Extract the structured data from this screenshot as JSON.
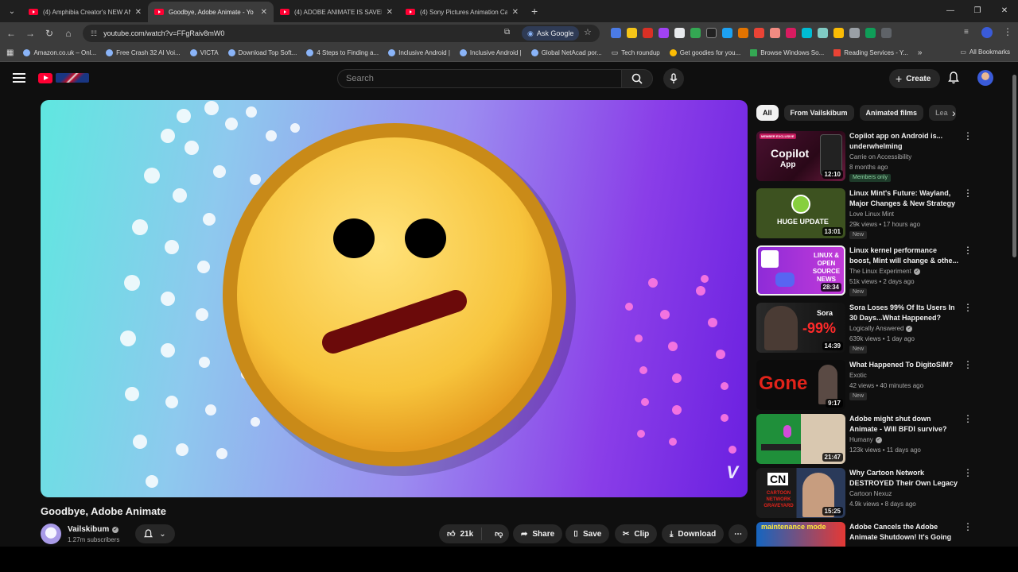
{
  "browser": {
    "tabs": [
      {
        "title": "(4) Amphibia Creator's NEW AN",
        "active": false
      },
      {
        "title": "Goodbye, Adobe Animate - Yo",
        "active": true
      },
      {
        "title": "(4) ADOBE ANIMATE IS SAVED",
        "active": false
      },
      {
        "title": "(4) Sony Pictures Animation Ca",
        "active": false
      }
    ],
    "url": "youtube.com/watch?v=FFgRaiv8mW0",
    "ask_google": "Ask Google",
    "bookmarks": [
      "Amazon.co.uk – Onl...",
      "Free Crash 32 AI Voi...",
      "VICTA",
      "Download Top Soft...",
      "4 Steps to Finding a...",
      "Inclusive Android |",
      "Inclusive Android |",
      "Global NetAcad por...",
      "Tech roundup",
      "Get goodies for you...",
      "Browse Windows So...",
      "Reading Services - Y..."
    ],
    "all_bookmarks": "All Bookmarks"
  },
  "header": {
    "search_placeholder": "Search",
    "create_label": "Create"
  },
  "video": {
    "title": "Goodbye, Adobe Animate",
    "watermark": "V",
    "channel": "Vailskibum",
    "subscribers": "1.27m subscribers",
    "likes": "21k",
    "share": "Share",
    "save": "Save",
    "clip": "Clip",
    "download": "Download"
  },
  "chips": [
    "All",
    "From Vailskibum",
    "Animated films",
    "Lea"
  ],
  "recommendations": [
    {
      "title": "Copilot app on Android is... underwhelming",
      "channel": "Carrie on Accessibility",
      "meta": "8 months ago",
      "badge": "Members only",
      "duration": "12:10",
      "thumb_text": "Copilot",
      "thumb_sub": "App",
      "thumb_tag": "MEMBER EXCLUSIVE"
    },
    {
      "title": "Linux Mint's Future: Wayland, Major Changes & New Strategy",
      "channel": "Love Linux Mint",
      "meta": "29k views • 17 hours ago",
      "badge": "New",
      "duration": "13:01",
      "thumb_text": "HUGE UPDATE"
    },
    {
      "title": "Linux kernel performance boost, Mint will change & othe...",
      "channel": "The Linux Experiment",
      "meta": "51k views • 2 days ago",
      "badge": "New",
      "duration": "28:34",
      "thumb_text": "LINUX & OPEN SOURCE NEWS"
    },
    {
      "title": "Sora Loses 99% Of Its Users In 30 Days...What Happened?",
      "channel": "Logically Answered",
      "meta": "639k views • 1 day ago",
      "badge": "New",
      "duration": "14:39",
      "thumb_text": "-99%",
      "thumb_tag": "Sora"
    },
    {
      "title": "What Happened To DigitoSIM?",
      "channel": "Exotic",
      "meta": "42 views • 40 minutes ago",
      "badge": "New",
      "duration": "9:17",
      "thumb_text": "Gone"
    },
    {
      "title": "Adobe might shut down Animate - Will BFDI survive?",
      "channel": "Humany",
      "meta": "123k views • 11 days ago",
      "badge": "",
      "duration": "21:47"
    },
    {
      "title": "Why Cartoon Network DESTROYED Their Own Legacy",
      "channel": "Cartoon Nexuz",
      "meta": "4.9k views • 8 days ago",
      "badge": "",
      "duration": "15:25",
      "thumb_text": "CN",
      "thumb_tag": "CARTOON NETWORK GRAVEYARD"
    },
    {
      "title": "Adobe Cancels the Adobe Animate Shutdown! It's Going ...",
      "channel": "",
      "meta": "",
      "badge": "",
      "duration": "",
      "thumb_text": "maintenance mode"
    }
  ],
  "colors": {
    "accent_red": "#ff0033",
    "background": "#0f0f0f"
  }
}
